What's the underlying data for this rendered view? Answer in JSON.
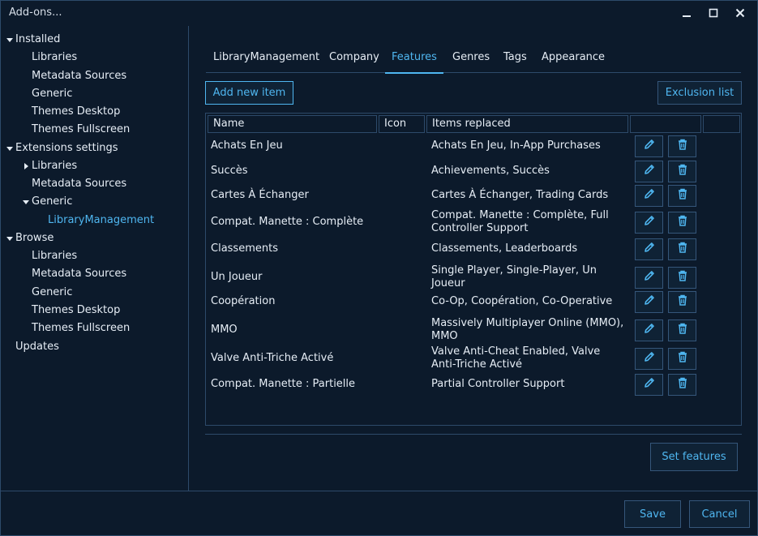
{
  "window": {
    "title": "Add-ons..."
  },
  "sidebar": {
    "installed": "Installed",
    "installed_items": [
      "Libraries",
      "Metadata Sources",
      "Generic",
      "Themes Desktop",
      "Themes Fullscreen"
    ],
    "extensions": "Extensions settings",
    "ext_libraries": "Libraries",
    "ext_metadata": "Metadata Sources",
    "ext_generic": "Generic",
    "ext_library_management": "LibraryManagement",
    "browse": "Browse",
    "browse_items": [
      "Libraries",
      "Metadata Sources",
      "Generic",
      "Themes Desktop",
      "Themes Fullscreen"
    ],
    "updates": "Updates"
  },
  "tabs": [
    "LibraryManagement",
    "Company",
    "Features",
    "Genres",
    "Tags",
    "Appearance"
  ],
  "active_tab": "Features",
  "toolbar": {
    "add_new_item": "Add new item",
    "exclusion_list": "Exclusion list"
  },
  "grid": {
    "headers": {
      "name": "Name",
      "icon": "Icon",
      "items_replaced": "Items replaced"
    },
    "rows": [
      {
        "name": "Achats En Jeu",
        "items": "Achats En Jeu, In-App Purchases"
      },
      {
        "name": "Succès",
        "items": "Achievements, Succès"
      },
      {
        "name": "Cartes À Échanger",
        "items": "Cartes À Échanger, Trading Cards"
      },
      {
        "name": "Compat. Manette : Complète",
        "items": "Compat. Manette : Complète, Full Controller Support"
      },
      {
        "name": "Classements",
        "items": "Classements, Leaderboards"
      },
      {
        "name": "Un Joueur",
        "items": "Single Player, Single-Player, Un Joueur"
      },
      {
        "name": "Coopération",
        "items": "Co-Op, Coopération, Co-Operative"
      },
      {
        "name": "MMO",
        "items": "Massively Multiplayer Online (MMO), MMO"
      },
      {
        "name": "Valve Anti-Triche Activé",
        "items": "Valve Anti-Cheat Enabled, Valve Anti-Triche Activé"
      },
      {
        "name": "Compat. Manette : Partielle",
        "items": "Partial Controller Support"
      }
    ]
  },
  "actions": {
    "set_features": "Set features",
    "save": "Save",
    "cancel": "Cancel"
  },
  "colors": {
    "accent": "#4fb6f0",
    "background": "#0c1a2b",
    "border": "#2d4a6a"
  },
  "icons": {
    "edit": "pencil-icon",
    "delete": "trash-icon",
    "minimize": "minimize-icon",
    "maximize": "maximize-icon",
    "close": "close-icon"
  }
}
